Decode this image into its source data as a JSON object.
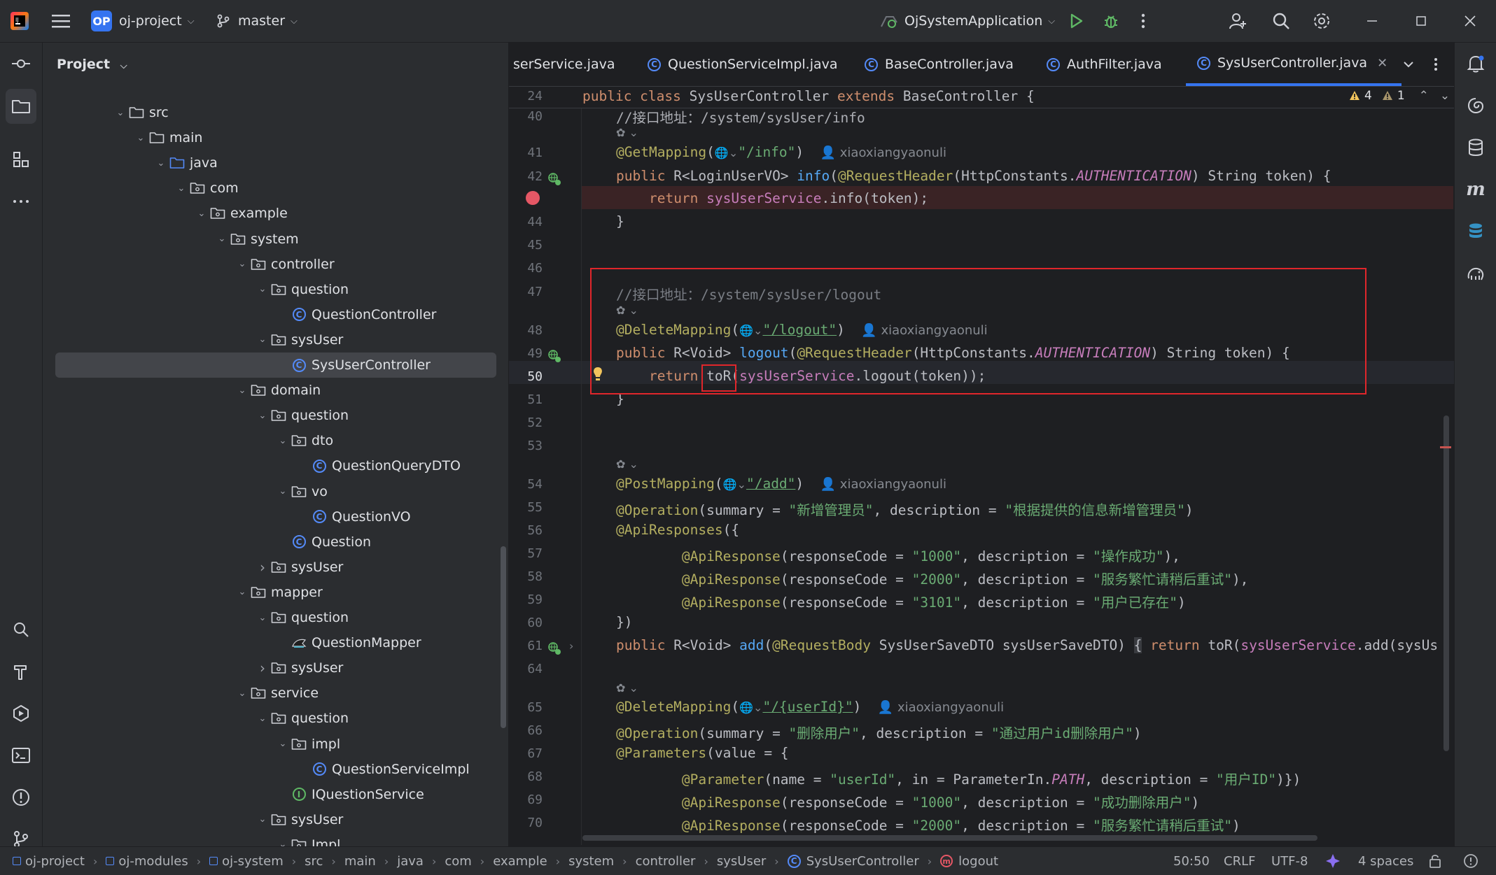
{
  "titlebar": {
    "project_badge": "OP",
    "project_name": "oj-project",
    "branch": "master",
    "run_config": "OjSystemApplication"
  },
  "project_panel": {
    "title": "Project",
    "tree": [
      {
        "label": "src",
        "type": "folder",
        "depth": 0,
        "open": true
      },
      {
        "label": "main",
        "type": "folder",
        "depth": 1,
        "open": true
      },
      {
        "label": "java",
        "type": "srcfolder",
        "depth": 2,
        "open": true
      },
      {
        "label": "com",
        "type": "package",
        "depth": 3,
        "open": true
      },
      {
        "label": "example",
        "type": "package",
        "depth": 4,
        "open": true
      },
      {
        "label": "system",
        "type": "package",
        "depth": 5,
        "open": true
      },
      {
        "label": "controller",
        "type": "package",
        "depth": 6,
        "open": true
      },
      {
        "label": "question",
        "type": "package",
        "depth": 7,
        "open": true
      },
      {
        "label": "QuestionController",
        "type": "class",
        "depth": 8
      },
      {
        "label": "sysUser",
        "type": "package",
        "depth": 7,
        "open": true
      },
      {
        "label": "SysUserController",
        "type": "class",
        "depth": 8,
        "selected": true
      },
      {
        "label": "domain",
        "type": "package",
        "depth": 6,
        "open": true
      },
      {
        "label": "question",
        "type": "package",
        "depth": 7,
        "open": true
      },
      {
        "label": "dto",
        "type": "package",
        "depth": 8,
        "open": true
      },
      {
        "label": "QuestionQueryDTO",
        "type": "class",
        "depth": 9
      },
      {
        "label": "vo",
        "type": "package",
        "depth": 8,
        "open": true
      },
      {
        "label": "QuestionVO",
        "type": "class",
        "depth": 9
      },
      {
        "label": "Question",
        "type": "class",
        "depth": 8
      },
      {
        "label": "sysUser",
        "type": "package",
        "depth": 7,
        "open": false
      },
      {
        "label": "mapper",
        "type": "package",
        "depth": 6,
        "open": true
      },
      {
        "label": "question",
        "type": "package",
        "depth": 7,
        "open": true
      },
      {
        "label": "QuestionMapper",
        "type": "mapper",
        "depth": 8
      },
      {
        "label": "sysUser",
        "type": "package",
        "depth": 7,
        "open": false
      },
      {
        "label": "service",
        "type": "package",
        "depth": 6,
        "open": true
      },
      {
        "label": "question",
        "type": "package",
        "depth": 7,
        "open": true
      },
      {
        "label": "impl",
        "type": "package",
        "depth": 8,
        "open": true
      },
      {
        "label": "QuestionServiceImpl",
        "type": "class",
        "depth": 9
      },
      {
        "label": "IQuestionService",
        "type": "interface",
        "depth": 8
      },
      {
        "label": "sysUser",
        "type": "package",
        "depth": 7,
        "open": true
      },
      {
        "label": "Impl",
        "type": "package",
        "depth": 8,
        "open": true
      }
    ]
  },
  "tabs": [
    {
      "label": "UserService.java",
      "shown": "serService.java",
      "icon": "interface"
    },
    {
      "label": "QuestionServiceImpl.java",
      "icon": "class"
    },
    {
      "label": "BaseController.java",
      "icon": "class"
    },
    {
      "label": "AuthFilter.java",
      "icon": "class"
    },
    {
      "label": "SysUserController.java",
      "icon": "class",
      "active": true
    }
  ],
  "editor": {
    "sticky_line": "24",
    "sticky_code": "public class SysUserController extends BaseController {",
    "warnings_count": "4",
    "weak_warnings_count": "1",
    "line_numbers": [
      "40",
      "41",
      "42",
      "43",
      "44",
      "45",
      "46",
      "47",
      "48",
      "49",
      "50",
      "51",
      "52",
      "53",
      "54",
      "55",
      "56",
      "57",
      "58",
      "59",
      "60",
      "61",
      "64",
      "65",
      "66",
      "67",
      "68",
      "69",
      "70"
    ],
    "author": "xiaoxiangyaonuli",
    "comment_info": "//接口地址：/system/sysUser/info",
    "comment_logout": "//接口地址：/system/sysUser/logout",
    "str_info": "\"/info\"",
    "str_logout": "\"/logout\"",
    "str_add": "\"/add\"",
    "str_userid": "\"/{userId}\"",
    "summary_add": "\"新增管理员\"",
    "desc_add": "\"根据提供的信息新增管理员\"",
    "code_1000": "\"1000\"",
    "code_2000": "\"2000\"",
    "code_3101": "\"3101\"",
    "msg_ok": "\"操作成功\"",
    "msg_busy": "\"服务繁忙请稍后重试\"",
    "msg_exists": "\"用户已存在\"",
    "summary_del": "\"删除用户\"",
    "desc_del": "\"通过用户id删除用户\"",
    "param_name": "\"userId\"",
    "param_desc": "\"用户ID\"",
    "msg_del_ok": "\"成功删除用户\""
  },
  "statusbar": {
    "breadcrumbs": [
      "oj-project",
      "oj-modules",
      "oj-system",
      "src",
      "main",
      "java",
      "com",
      "example",
      "system",
      "controller",
      "sysUser",
      "SysUserController",
      "logout"
    ],
    "position": "50:50",
    "line_sep": "CRLF",
    "encoding": "UTF-8",
    "indent": "4 spaces"
  }
}
